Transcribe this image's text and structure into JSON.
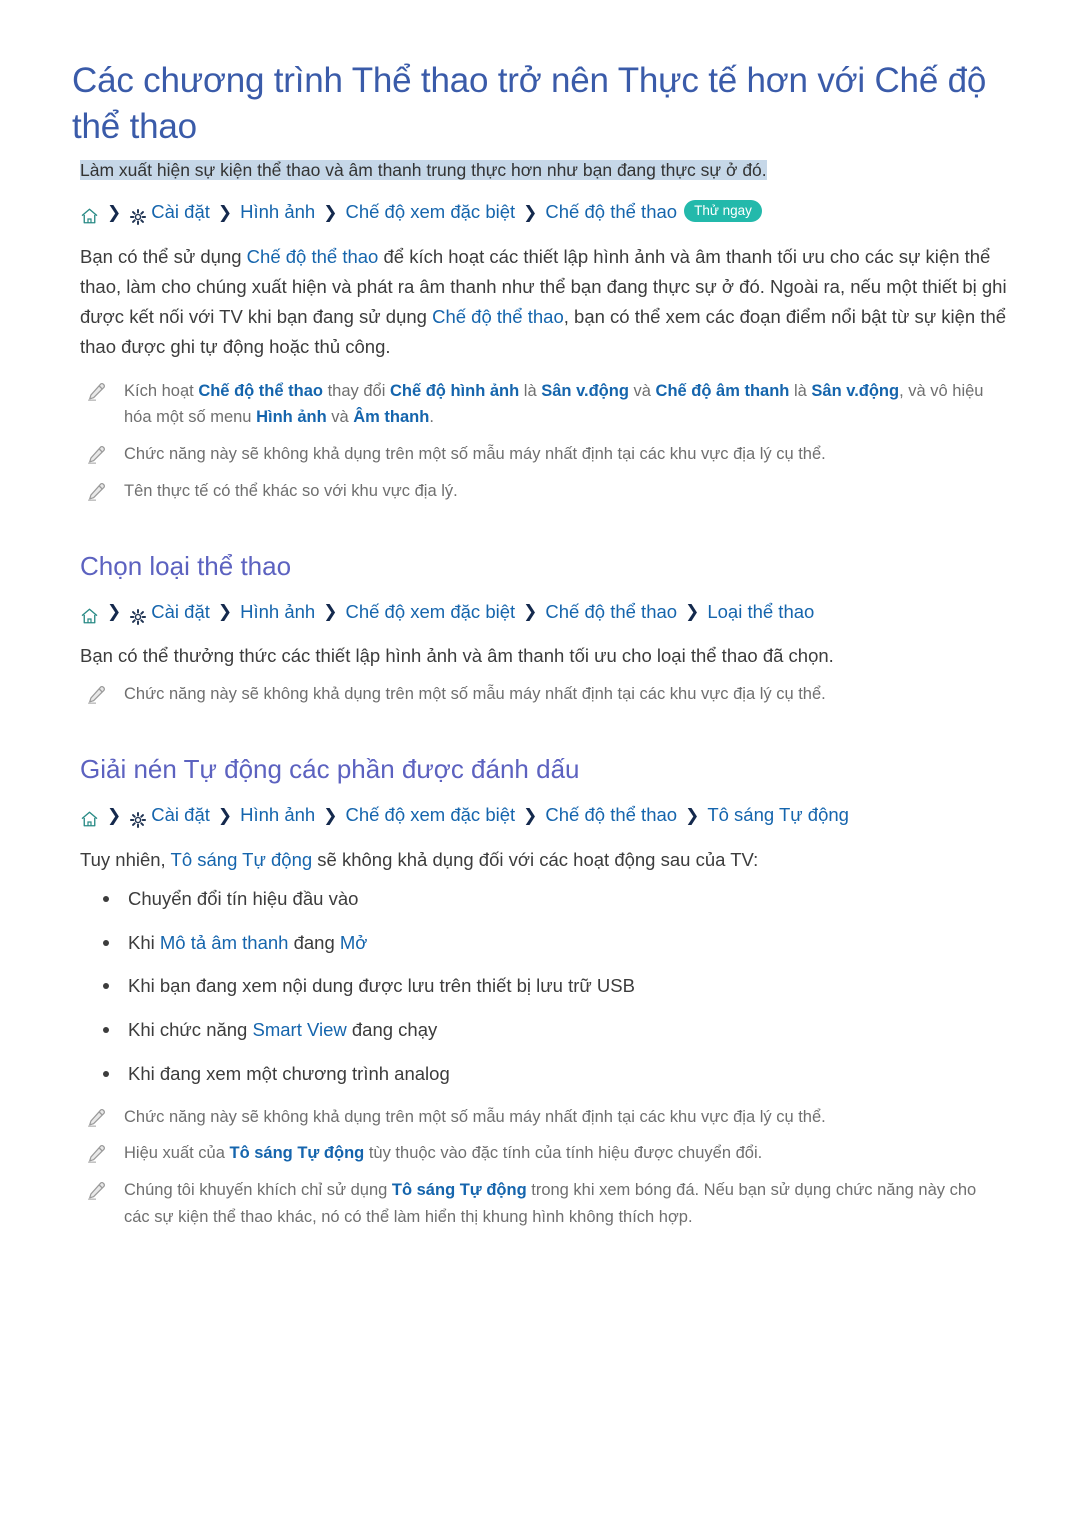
{
  "doc": {
    "title": "Các chương trình Thể thao trở nên Thực tế hơn với Chế độ thể thao",
    "subtitle": "Làm xuất hiện sự kiện thể thao và âm thanh trung thực hơn như bạn đang thực sự ở đó."
  },
  "breadcrumb_main": {
    "home_icon": "home-icon",
    "gear_icon": "gear-icon",
    "separator": "❯",
    "items": [
      "Cài đặt",
      "Hình ảnh",
      "Chế độ xem đặc biệt",
      "Chế độ thể thao"
    ],
    "badge": "Thử ngay"
  },
  "intro": {
    "p1_a": "Bạn có thể sử dụng ",
    "p1_link1": "Chế độ thể thao",
    "p1_b": " để kích hoạt các thiết lập hình ảnh và âm thanh tối ưu cho các sự kiện thể thao, làm cho chúng xuất hiện và phát ra âm thanh như thể bạn đang thực sự ở đó. Ngoài ra, nếu một thiết bị ghi được kết nối với TV khi bạn đang sử dụng ",
    "p1_link2": "Chế độ thể thao",
    "p1_c": ", bạn có thể xem các đoạn điểm nổi bật từ sự kiện thể thao được ghi tự động hoặc thủ công."
  },
  "notes_intro": [
    {
      "icon": "pencil-icon",
      "parts": [
        {
          "t": "Kích hoạt ",
          "style": "plain"
        },
        {
          "t": "Chế độ thể thao",
          "style": "link"
        },
        {
          "t": " thay đổi ",
          "style": "plain"
        },
        {
          "t": "Chế độ hình ảnh",
          "style": "link"
        },
        {
          "t": " là ",
          "style": "plain"
        },
        {
          "t": "Sân v.động",
          "style": "link"
        },
        {
          "t": " và ",
          "style": "plain"
        },
        {
          "t": "Chế độ âm thanh",
          "style": "link"
        },
        {
          "t": " là ",
          "style": "plain"
        },
        {
          "t": "Sân v.động",
          "style": "link"
        },
        {
          "t": ", và vô hiệu hóa một số menu ",
          "style": "plain"
        },
        {
          "t": "Hình ảnh",
          "style": "link"
        },
        {
          "t": " và ",
          "style": "plain"
        },
        {
          "t": "Âm thanh",
          "style": "link"
        },
        {
          "t": ".",
          "style": "plain"
        }
      ]
    },
    {
      "icon": "pencil-icon",
      "parts": [
        {
          "t": "Chức năng này sẽ không khả dụng trên một số mẫu máy nhất định tại các khu vực địa lý cụ thể.",
          "style": "plain"
        }
      ]
    },
    {
      "icon": "pencil-icon",
      "parts": [
        {
          "t": "Tên thực tế có thể khác so với khu vực địa lý.",
          "style": "plain"
        }
      ]
    }
  ],
  "section2": {
    "title": "Chọn loại thể thao",
    "breadcrumb": {
      "home_icon": "home-icon",
      "gear_icon": "gear-icon",
      "separator": "❯",
      "items": [
        "Cài đặt",
        "Hình ảnh",
        "Chế độ xem đặc biệt",
        "Chế độ thể thao",
        "Loại thể thao"
      ]
    },
    "paragraph": "Bạn có thể thưởng thức các thiết lập hình ảnh và âm thanh tối ưu cho loại thể thao đã chọn.",
    "note": "Chức năng này sẽ không khả dụng trên một số mẫu máy nhất định tại các khu vực địa lý cụ thể."
  },
  "section3": {
    "title": "Giải nén Tự động các phần được đánh dấu",
    "breadcrumb": {
      "home_icon": "home-icon",
      "gear_icon": "gear-icon",
      "separator": "❯",
      "items": [
        "Cài đặt",
        "Hình ảnh",
        "Chế độ xem đặc biệt",
        "Chế độ thể thao",
        "Tô sáng Tự động"
      ]
    },
    "lead_a": "Tuy nhiên, ",
    "lead_link": "Tô sáng Tự động",
    "lead_b": " sẽ không khả dụng đối với các hoạt động sau của TV:",
    "bullets": [
      [
        {
          "t": "Chuyển đổi tín hiệu đầu vào",
          "style": "plain"
        }
      ],
      [
        {
          "t": "Khi ",
          "style": "plain"
        },
        {
          "t": "Mô tả âm thanh",
          "style": "link"
        },
        {
          "t": " đang ",
          "style": "plain"
        },
        {
          "t": "Mở",
          "style": "link"
        }
      ],
      [
        {
          "t": "Khi bạn đang xem nội dung được lưu trên thiết bị lưu trữ USB",
          "style": "plain"
        }
      ],
      [
        {
          "t": "Khi chức năng ",
          "style": "plain"
        },
        {
          "t": "Smart View",
          "style": "link"
        },
        {
          "t": " đang chạy",
          "style": "plain"
        }
      ],
      [
        {
          "t": "Khi đang xem một chương trình analog",
          "style": "plain"
        }
      ]
    ],
    "notes": [
      {
        "icon": "pencil-icon",
        "parts": [
          {
            "t": "Chức năng này sẽ không khả dụng trên một số mẫu máy nhất định tại các khu vực địa lý cụ thể.",
            "style": "plain"
          }
        ]
      },
      {
        "icon": "pencil-icon",
        "parts": [
          {
            "t": "Hiệu xuất của ",
            "style": "plain"
          },
          {
            "t": "Tô sáng Tự động",
            "style": "link"
          },
          {
            "t": " tùy thuộc vào đặc tính của tính hiệu được chuyển đổi.",
            "style": "plain"
          }
        ]
      },
      {
        "icon": "pencil-icon",
        "parts": [
          {
            "t": "Chúng tôi khuyến khích chỉ sử dụng ",
            "style": "plain"
          },
          {
            "t": "Tô sáng Tự động",
            "style": "link"
          },
          {
            "t": " trong khi xem bóng đá. Nếu bạn sử dụng chức năng này cho các sự kiện thể thao khác, nó có thể làm hiển thị khung hình không thích hợp.",
            "style": "plain"
          }
        ]
      }
    ]
  },
  "colors": {
    "title_blue": "#3a5ba9",
    "section_violet": "#5c62c0",
    "link_blue": "#1565ad",
    "badge_teal": "#23b9ab",
    "highlight_bg": "#c6d7e8",
    "note_gray": "#6f6f6f",
    "body_gray": "#3c3c3c"
  }
}
